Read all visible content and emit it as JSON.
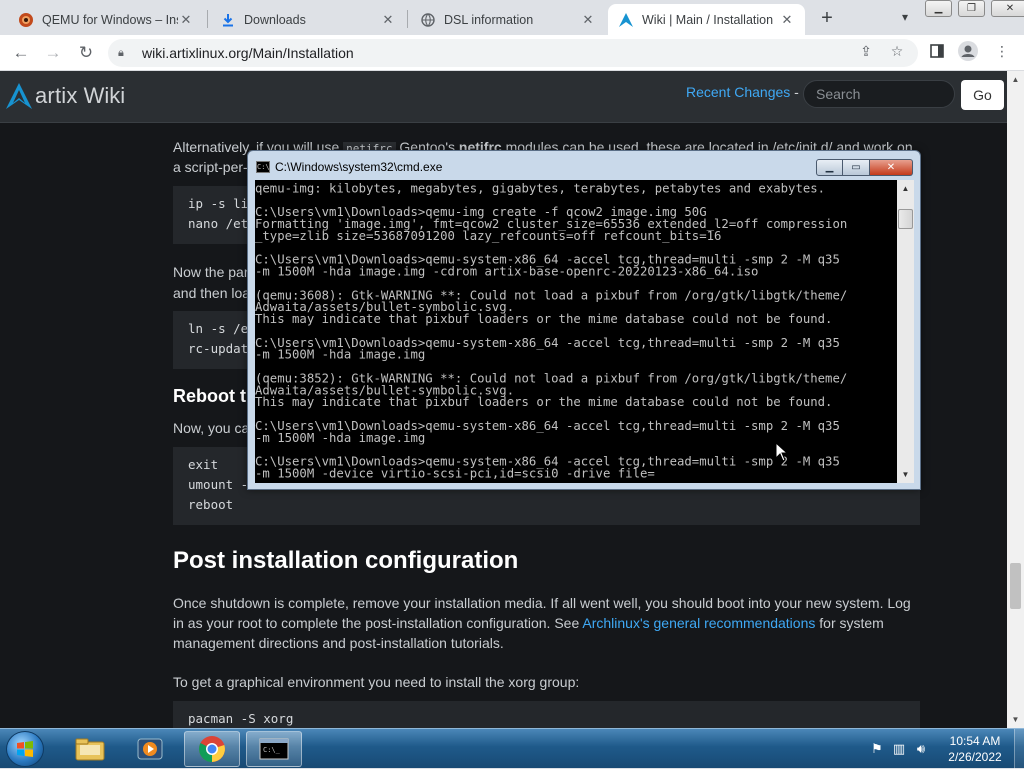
{
  "browser": {
    "tabs": [
      {
        "title": "QEMU for Windows – Ins",
        "active": false
      },
      {
        "title": "Downloads",
        "active": false
      },
      {
        "title": "DSL information",
        "active": false
      },
      {
        "title": "Wiki | Main / Installation",
        "active": true
      }
    ],
    "url": "wiki.artixlinux.org/Main/Installation"
  },
  "wiki": {
    "brand": "artix",
    "wiki_word": "Wiki",
    "recent_changes": "Recent Changes",
    "recent_sep": " -",
    "search_placeholder": "Search",
    "go_label": "Go",
    "para1": "Alternatively, if you will use",
    "para1_b": "Gentoo's",
    "para1_c": "netifrc",
    "para1_d": "modules can be used, these are located in /etc/init.d/ and work on",
    "para1_line2": "a script-per-",
    "code1_l1": "ip -s li",
    "code1_l2": "nano /et",
    "para2_l1": "Now the par",
    "para2_l2": "and then loa",
    "code2_l1": "ln -s /e",
    "code2_l2": "rc-updat",
    "h3_reboot": "Reboot t",
    "para3": "Now, you ca",
    "code3_l1": "exit",
    "code3_l2": "umount -",
    "code3_l3": "reboot",
    "h2_post": "Post installation configuration",
    "post_p1_a": "Once shutdown is complete, remove your installation media. If all went well, you should boot into your new system. Log in as your root to complete the post-installation configuration. See ",
    "post_p1_link": "Archlinux's general recommendations",
    "post_p1_b": " for system management directions and post-installation tutorials.",
    "post_p2": "To get a graphical environment you need to install the xorg group:",
    "code4_l1": "pacman -S xorg"
  },
  "cmd": {
    "title": "C:\\Windows\\system32\\cmd.exe",
    "icon_text": "C:\\",
    "output": "qemu-img: kilobytes, megabytes, gigabytes, terabytes, petabytes and exabytes.\n\nC:\\Users\\vm1\\Downloads>qemu-img create -f qcow2 image.img 50G\nFormatting 'image.img', fmt=qcow2 cluster_size=65536 extended_l2=off compression\n_type=zlib size=53687091200 lazy_refcounts=off refcount_bits=16\n\nC:\\Users\\vm1\\Downloads>qemu-system-x86_64 -accel tcg,thread=multi -smp 2 -M q35\n-m 1500M -hda image.img -cdrom artix-base-openrc-20220123-x86_64.iso\n\n(qemu:3608): Gtk-WARNING **: Could not load a pixbuf from /org/gtk/libgtk/theme/\nAdwaita/assets/bullet-symbolic.svg.\nThis may indicate that pixbuf loaders or the mime database could not be found.\n\nC:\\Users\\vm1\\Downloads>qemu-system-x86_64 -accel tcg,thread=multi -smp 2 -M q35\n-m 1500M -hda image.img\n\n(qemu:3852): Gtk-WARNING **: Could not load a pixbuf from /org/gtk/libgtk/theme/\nAdwaita/assets/bullet-symbolic.svg.\nThis may indicate that pixbuf loaders or the mime database could not be found.\n\nC:\\Users\\vm1\\Downloads>qemu-system-x86_64 -accel tcg,thread=multi -smp 2 -M q35\n-m 1500M -hda image.img\n\nC:\\Users\\vm1\\Downloads>qemu-system-x86_64 -accel tcg,thread=multi -smp 2 -M q35\n-m 1500M -device virtio-scsi-pci,id=scsi0 -drive file="
  },
  "taskbar": {
    "time": "10:54 AM",
    "date": "2/26/2022"
  },
  "colors": {
    "link": "#3fa9f5",
    "page_bg": "#15171a",
    "header_bg": "#2b2f33"
  }
}
